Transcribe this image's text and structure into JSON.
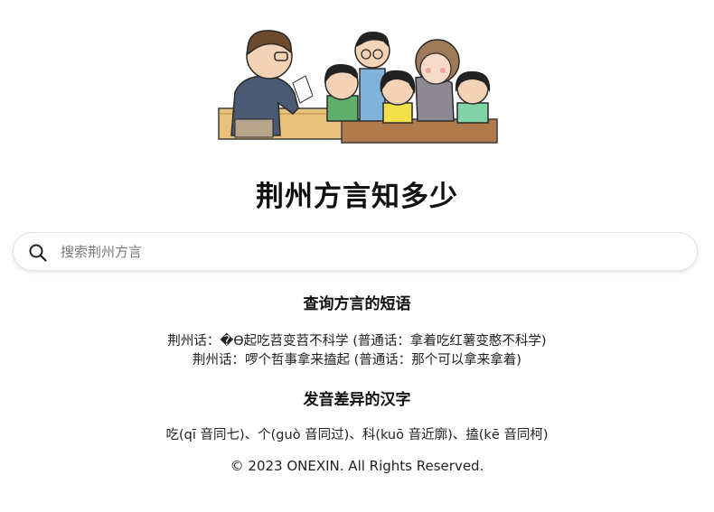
{
  "header": {
    "illustration": "classroom-teacher-and-students",
    "title": "荆州方言知多少"
  },
  "search": {
    "icon": "search-icon",
    "placeholder": "搜索荆州方言"
  },
  "sections": [
    {
      "title": "查询方言的短语",
      "lines": [
        "荆州话：�Ө起吃苕变苕不科学 (普通话：拿着吃红薯变憨不科学)",
        "荆州话：啰个哲事拿来搕起 (普通话：那个可以拿来拿着)"
      ]
    },
    {
      "title": "发音差异的汉字",
      "lines": [
        "吃(qī 音同七)、个(guò 音同过)、科(kuō 音近廓)、搕(kē 音同柯)"
      ]
    }
  ],
  "footer": {
    "copyright": "© 2023 ONEXIN. All Rights Reserved."
  }
}
